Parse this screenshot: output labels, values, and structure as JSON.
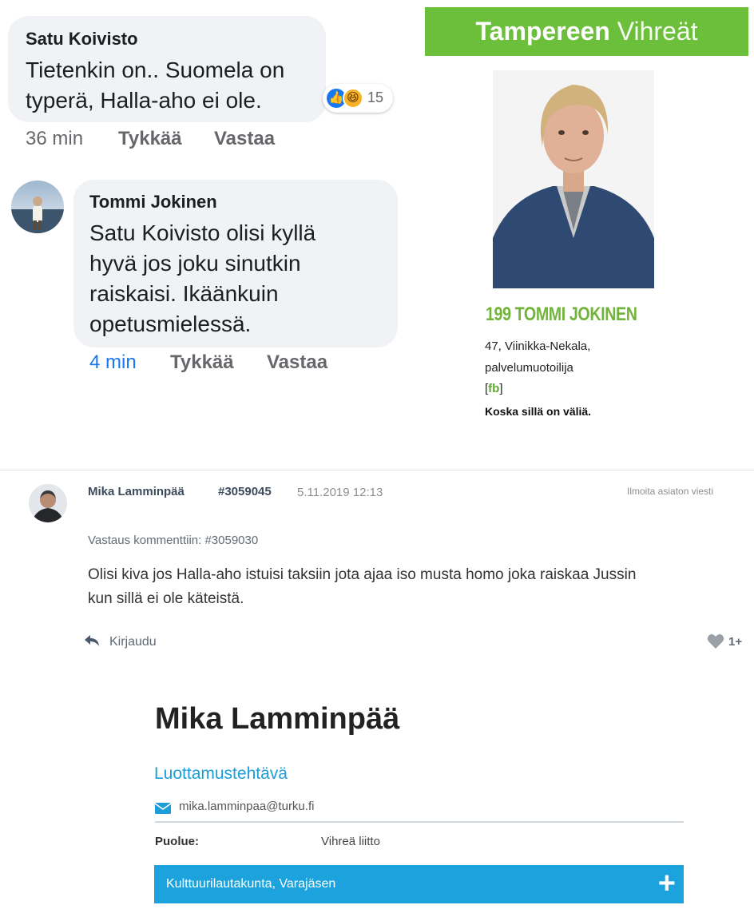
{
  "comments": [
    {
      "author": "Satu Koivisto",
      "lines": [
        "Tietenkin on.. Suomela on",
        "typerä, Halla-aho ei ole."
      ],
      "time": "36 min",
      "like_label": "Tykkää",
      "reply_label": "Vastaa",
      "reactions": {
        "icons": [
          "like-icon",
          "haha-icon"
        ],
        "count": "15"
      }
    },
    {
      "author": "Tommi Jokinen",
      "lines": [
        "Satu Koivisto olisi kyllä",
        "hyvä jos joku sinutkin",
        "raiskaisi. Ikäänkuin",
        "opetusmielessä."
      ],
      "time": "4 min",
      "like_label": "Tykkää",
      "reply_label": "Vastaa"
    }
  ],
  "candidate": {
    "banner_bold": "Tampereen",
    "banner_thin": "Vihreät",
    "banner_color": "#6bbf3a",
    "name": "199 TOMMI JOKINEN",
    "info_line1": "47, Viinikka-Nekala,",
    "info_line2": "palvelumuotoilija",
    "fb_open": "[",
    "fb_label": "fb",
    "fb_close": "]",
    "slogan": "Koska sillä on väliä."
  },
  "forum_post": {
    "author": "Mika Lamminpää",
    "post_id": "#3059045",
    "date": "5.11.2019 12:13",
    "report_label": "Ilmoita asiaton viesti",
    "reply_to": "Vastaus kommenttiin: #3059030",
    "body_line1": "Olisi kiva jos Halla-aho istuisi taksiin jota ajaa iso musta homo joka raiskaa Jussin",
    "body_line2": "kun sillä ei ole käteistä.",
    "reply_label": "Kirjaudu",
    "like_count": "1+"
  },
  "profile": {
    "name": "Mika Lamminpää",
    "section_title": "Luottamustehtävä",
    "email": "mika.lamminpaa@turku.fi",
    "party_label": "Puolue:",
    "party_value": "Vihreä liitto",
    "committee": "Kulttuurilautakunta, Varajäsen",
    "accent_color": "#1ca3dd"
  }
}
